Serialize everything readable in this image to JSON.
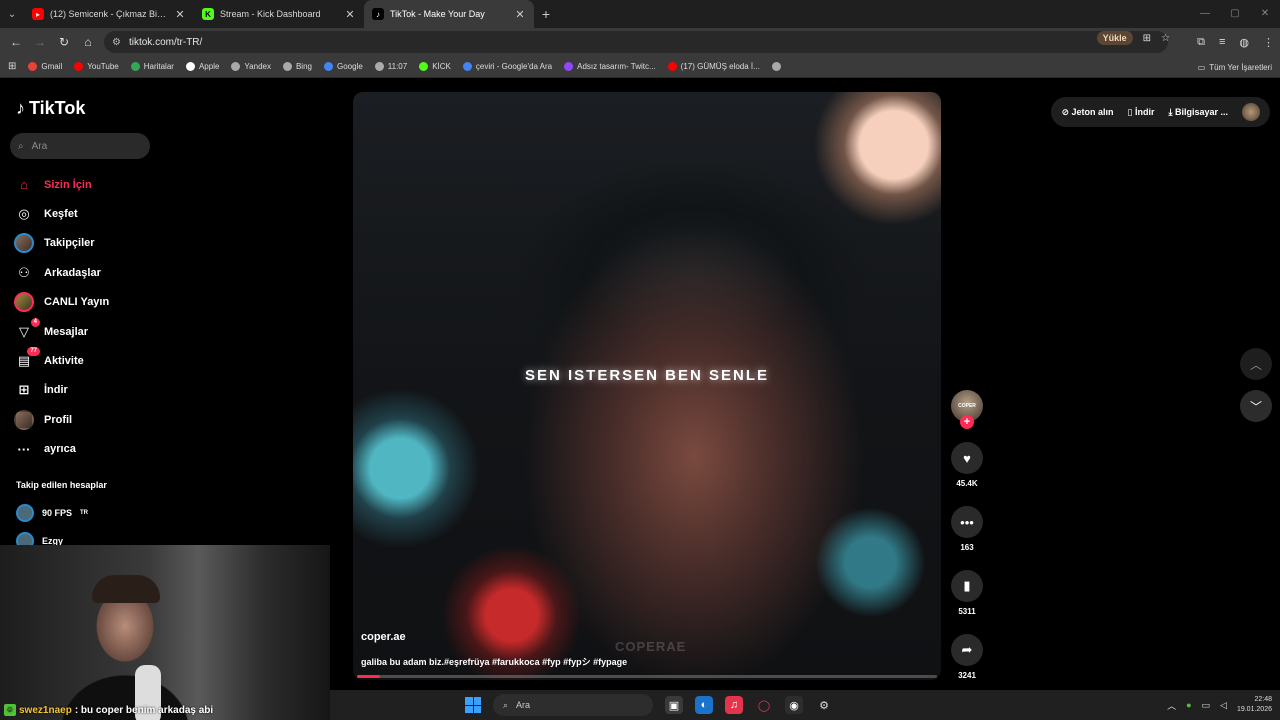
{
  "browser": {
    "tabs": [
      {
        "title": "(12) Semicenk - Çıkmaz Bir Sok",
        "favicon_color": "#ff0000",
        "active": false
      },
      {
        "title": "Stream - Kick Dashboard",
        "favicon_color": "#53fc18",
        "active": false
      },
      {
        "title": "TikTok - Make Your Day",
        "favicon_color": "#000000",
        "active": true
      }
    ],
    "url": "tiktok.com/tr-TR/",
    "install_label": "Yükle",
    "bookmarks": [
      {
        "label": "Gmail",
        "color": "#ea4335"
      },
      {
        "label": "YouTube",
        "color": "#ff0000"
      },
      {
        "label": "Haritalar",
        "color": "#34a853"
      },
      {
        "label": "Apple",
        "color": "#ffffff"
      },
      {
        "label": "Yandex",
        "color": "#aaaaaa"
      },
      {
        "label": "Bing",
        "color": "#aaaaaa"
      },
      {
        "label": "Google",
        "color": "#4285f4"
      },
      {
        "label": "11:07",
        "color": "#aaaaaa"
      },
      {
        "label": "KİCK",
        "color": "#53fc18"
      },
      {
        "label": "çeviri - Google'da Ara",
        "color": "#4285f4"
      },
      {
        "label": "Adsız tasarım- Twitc...",
        "color": "#9146ff"
      },
      {
        "label": "(17) GÜMÜŞ eloda İ...",
        "color": "#ff0000"
      },
      {
        "label": "",
        "color": "#aaaaaa"
      }
    ],
    "all_bookmarks_label": "Tüm Yer İşaretleri"
  },
  "tiktok": {
    "brand": "TikTok",
    "search_placeholder": "Ara",
    "nav": [
      {
        "label": "Sizin İçin",
        "icon": "home-icon",
        "active": true
      },
      {
        "label": "Keşfet",
        "icon": "compass-icon"
      },
      {
        "label": "Takipçiler",
        "icon": "avatar"
      },
      {
        "label": "Arkadaşlar",
        "icon": "friends-icon"
      },
      {
        "label": "CANLI Yayın",
        "icon": "live-avatar"
      },
      {
        "label": "Mesajlar",
        "icon": "send-icon",
        "badge": "4"
      },
      {
        "label": "Aktivite",
        "icon": "inbox-icon",
        "badge": "77"
      },
      {
        "label": "İndir",
        "icon": "plus-square-icon"
      },
      {
        "label": "Profil",
        "icon": "avatar"
      },
      {
        "label": "ayrıca",
        "icon": "more-icon"
      }
    ],
    "following_title": "Takip edilen hesaplar",
    "following": [
      {
        "name": "90 FPS",
        "suffix": "TR"
      },
      {
        "name": "Ezgy",
        "suffix": ""
      }
    ],
    "top_right": {
      "coins": "Jeton alın",
      "download": "İndir",
      "computer": "Bilgisayar ..."
    },
    "video": {
      "caption": "SEN ISTERSEN BEN SENLE",
      "watermark": "COPERAE",
      "author": "coper.ae",
      "description": "galiba bu adam biz.#eşrefrüya #farukkoca #fyp #fypシ #fypage",
      "progress": 0.04
    },
    "actions": {
      "avatar_text": "COPER",
      "likes": "45.4K",
      "comments": "163",
      "saves": "5311",
      "shares": "3241"
    }
  },
  "stream_overlay": {
    "chat_user": "swez1naep",
    "chat_message": ": bu coper benim arkadaş abi"
  },
  "taskbar": {
    "search_placeholder": "Ara",
    "time": "22:48",
    "date": "19.01.2026"
  }
}
